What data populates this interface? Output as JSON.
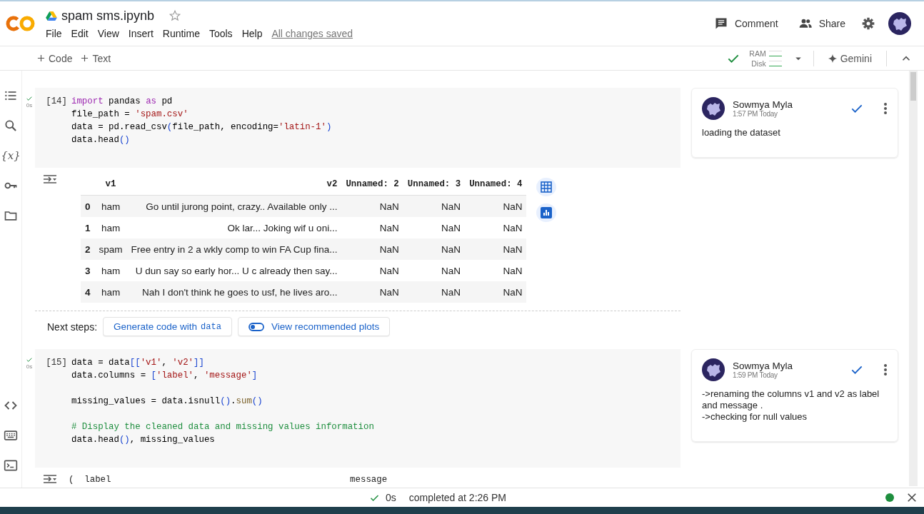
{
  "header": {
    "title": "spam sms.ipynb",
    "starred": false,
    "menu": [
      "File",
      "Edit",
      "View",
      "Insert",
      "Runtime",
      "Tools",
      "Help"
    ],
    "save_status": "All changes saved",
    "actions": [
      {
        "label": "Comment"
      },
      {
        "label": "Share"
      }
    ]
  },
  "toolbar": {
    "add_buttons": [
      "Code",
      "Text"
    ],
    "runtime": {
      "connected": true,
      "ram_label": "RAM",
      "disk_label": "Disk"
    },
    "gemini": "Gemini"
  },
  "sidebar": {
    "variables_glyph": "{x}"
  },
  "cells": [
    {
      "exec_count": "[14]",
      "succeeded": true,
      "duration": "0s",
      "code_blocks": [
        {
          "lines": [
            {
              "tokens": [
                {
                  "t": "import",
                  "kind": "kw"
                },
                {
                  "t": " pandas ",
                  "kind": "plain"
                },
                {
                  "t": "as",
                  "kind": "kw"
                },
                {
                  "t": " pd",
                  "kind": "plain"
                }
              ]
            },
            {
              "tokens": [
                {
                  "t": "file_path = ",
                  "kind": "plain"
                },
                {
                  "t": "'spam.csv'",
                  "kind": "str"
                }
              ]
            },
            {
              "tokens": [
                {
                  "t": "data = pd.read_csv",
                  "kind": "plain"
                },
                {
                  "t": "(",
                  "kind": "paren"
                },
                {
                  "t": "file_path, encoding=",
                  "kind": "plain"
                },
                {
                  "t": "'latin-1'",
                  "kind": "str"
                },
                {
                  "t": ")",
                  "kind": "paren"
                }
              ]
            },
            {
              "tokens": [
                {
                  "t": "data.head",
                  "kind": "plain"
                },
                {
                  "t": "()",
                  "kind": "paren"
                }
              ]
            }
          ]
        }
      ],
      "output": {
        "kind": "dataframe",
        "columns": [
          "v1",
          "v2",
          "Unnamed: 2",
          "Unnamed: 3",
          "Unnamed: 4"
        ],
        "rows": [
          {
            "index": "0",
            "cells": [
              "ham",
              "Go until jurong point, crazy.. Available only ...",
              "NaN",
              "NaN",
              "NaN"
            ]
          },
          {
            "index": "1",
            "cells": [
              "ham",
              "Ok lar... Joking wif u oni...",
              "NaN",
              "NaN",
              "NaN"
            ]
          },
          {
            "index": "2",
            "cells": [
              "spam",
              "Free entry in 2 a wkly comp to win FA Cup fina...",
              "NaN",
              "NaN",
              "NaN"
            ]
          },
          {
            "index": "3",
            "cells": [
              "ham",
              "U dun say so early hor... U c already then say...",
              "NaN",
              "NaN",
              "NaN"
            ]
          },
          {
            "index": "4",
            "cells": [
              "ham",
              "Nah I don't think he goes to usf, he lives aro...",
              "NaN",
              "NaN",
              "NaN"
            ]
          }
        ],
        "next_steps": {
          "label": "Next steps:",
          "generate": {
            "text": "Generate code with",
            "var": "data"
          },
          "plots": "View recommended plots"
        }
      },
      "comment": {
        "author": "Sowmya Myla",
        "time": "1:57 PM Today",
        "text": "loading the dataset"
      }
    },
    {
      "exec_count": "[15]",
      "succeeded": true,
      "duration": "0s",
      "code_blocks": [
        {
          "lines": [
            {
              "tokens": [
                {
                  "t": "data = data",
                  "kind": "plain"
                },
                {
                  "t": "[[",
                  "kind": "paren"
                },
                {
                  "t": "'v1'",
                  "kind": "str"
                },
                {
                  "t": ", ",
                  "kind": "plain"
                },
                {
                  "t": "'v2'",
                  "kind": "str"
                },
                {
                  "t": "]]",
                  "kind": "paren"
                }
              ]
            },
            {
              "tokens": [
                {
                  "t": "data.columns = ",
                  "kind": "plain"
                },
                {
                  "t": "[",
                  "kind": "paren"
                },
                {
                  "t": "'label'",
                  "kind": "str"
                },
                {
                  "t": ", ",
                  "kind": "plain"
                },
                {
                  "t": "'message'",
                  "kind": "str"
                },
                {
                  "t": "]",
                  "kind": "paren"
                }
              ]
            }
          ]
        },
        {
          "lines": [
            {
              "tokens": [
                {
                  "t": "missing_values = data.isnull",
                  "kind": "plain"
                },
                {
                  "t": "()",
                  "kind": "paren"
                },
                {
                  "t": ".",
                  "kind": "plain"
                },
                {
                  "t": "sum",
                  "kind": "fn"
                },
                {
                  "t": "()",
                  "kind": "paren"
                }
              ]
            }
          ]
        },
        {
          "lines": [
            {
              "tokens": [
                {
                  "t": "# Display the cleaned data and missing values information",
                  "kind": "comment"
                }
              ]
            },
            {
              "tokens": [
                {
                  "t": "data.head",
                  "kind": "plain"
                },
                {
                  "t": "()",
                  "kind": "paren"
                },
                {
                  "t": ", missing_values",
                  "kind": "plain"
                }
              ]
            }
          ]
        }
      ],
      "output": {
        "kind": "text",
        "lines": [
          "(  label                                             message"
        ]
      },
      "comment": {
        "author": "Sowmya Myla",
        "time": "1:59 PM Today",
        "text": "->renaming the columns v1 and v2 as label and message .\n->checking for null values"
      }
    }
  ],
  "status_bar": {
    "succeeded": true,
    "duration": "0s",
    "message": "completed at 2:26 PM",
    "connected": true
  }
}
